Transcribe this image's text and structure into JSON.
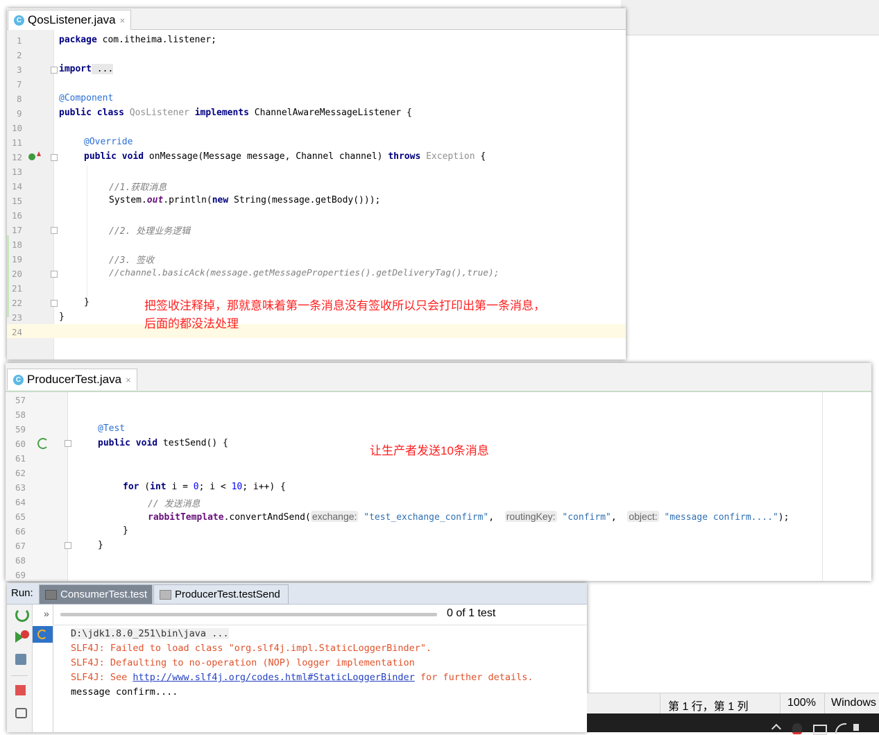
{
  "editor1": {
    "tab_label": "QosListener.java",
    "tab_icon_letter": "C",
    "close_glyph": "×",
    "line_numbers": [
      "1",
      "2",
      "3",
      "7",
      "8",
      "9",
      "10",
      "11",
      "12",
      "13",
      "14",
      "15",
      "16",
      "17",
      "18",
      "19",
      "20",
      "21",
      "22",
      "23",
      "24"
    ],
    "code": {
      "l1_kw": "package",
      "l1_rest": " com.itheima.listener;",
      "l3_kw": "import",
      "l3_rest": " ...",
      "l8": "@Component",
      "l9_kw1": "public",
      "l9_kw2": "class",
      "l9_name": "QosListener",
      "l9_kw3": "implements",
      "l9_rest": " ChannelAwareMessageListener {",
      "l11": "@Override",
      "l12_kw1": "public",
      "l12_kw2": "void",
      "l12_mid": " onMessage(Message message, Channel channel) ",
      "l12_kw3": "throws",
      "l12_exc": "Exception",
      "l12_end": " {",
      "l14": "//1.获取消息",
      "l15_a": "System.",
      "l15_out": "out",
      "l15_b": ".println(",
      "l15_kw": "new",
      "l15_c": " String(message.getBody()));",
      "l17": "//2. 处理业务逻辑",
      "l19": "//3. 签收",
      "l20": "//channel.basicAck(message.getMessageProperties().getDeliveryTag(),true);",
      "l22": "}",
      "l23": "}"
    },
    "note_line1": "把签收注释掉，那就意味着第一条消息没有签收所以只会打印出第一条消息，",
    "note_line2": "后面的都没法处理"
  },
  "editor2": {
    "tab_label": "ProducerTest.java",
    "tab_icon_letter": "C",
    "close_glyph": "×",
    "line_numbers": [
      "57",
      "58",
      "59",
      "60",
      "61",
      "62",
      "63",
      "64",
      "65",
      "66",
      "67",
      "68",
      "69"
    ],
    "code": {
      "l59": "@Test",
      "l60_kw1": "public",
      "l60_kw2": "void",
      "l60_rest": " testSend() {",
      "l63_kw": "for",
      "l63_a": " (",
      "l63_kw2": "int",
      "l63_b": " i = ",
      "l63_n0": "0",
      "l63_c": "; i < ",
      "l63_n10": "10",
      "l63_d": "; i++) {",
      "l64": "// 发送消息",
      "l65_field": "rabbitTemplate",
      "l65_a": ".convertAndSend(",
      "l65_h1": "exchange:",
      "l65_s1": "\"test_exchange_confirm\"",
      "l65_h2": "routingKey:",
      "l65_s2": "\"confirm\"",
      "l65_h3": "object:",
      "l65_s3": "\"message confirm....\"",
      "l65_end": ");",
      "l66": "}",
      "l67": "}"
    },
    "note": "让生产者发送10条消息"
  },
  "run": {
    "label": "Run:",
    "tabs": [
      {
        "label": "ConsumerTest.test"
      },
      {
        "label": "ProducerTest.testSend"
      }
    ],
    "chevron": "»",
    "test_count": "0 of 1 test",
    "console": {
      "line1": "D:\\jdk1.8.0_251\\bin\\java ...",
      "line2": "SLF4J: Failed to load class \"org.slf4j.impl.StaticLoggerBinder\".",
      "line3": "SLF4J: Defaulting to no-operation (NOP) logger implementation",
      "line4_a": "SLF4J: See ",
      "line4_link": "http://www.slf4j.org/codes.html#StaticLoggerBinder",
      "line4_b": " for further details.",
      "line5": "message confirm...."
    }
  },
  "statusbar": {
    "position": "第 1 行，第 1 列",
    "zoom": "100%",
    "encoding": "Windows"
  },
  "colors": {
    "keyword": "#000080",
    "annotation": "#808000",
    "comment": "#808080",
    "red_note": "#ff2020",
    "error_console": "#e0522b",
    "run_bar": "#dfe6ef"
  }
}
